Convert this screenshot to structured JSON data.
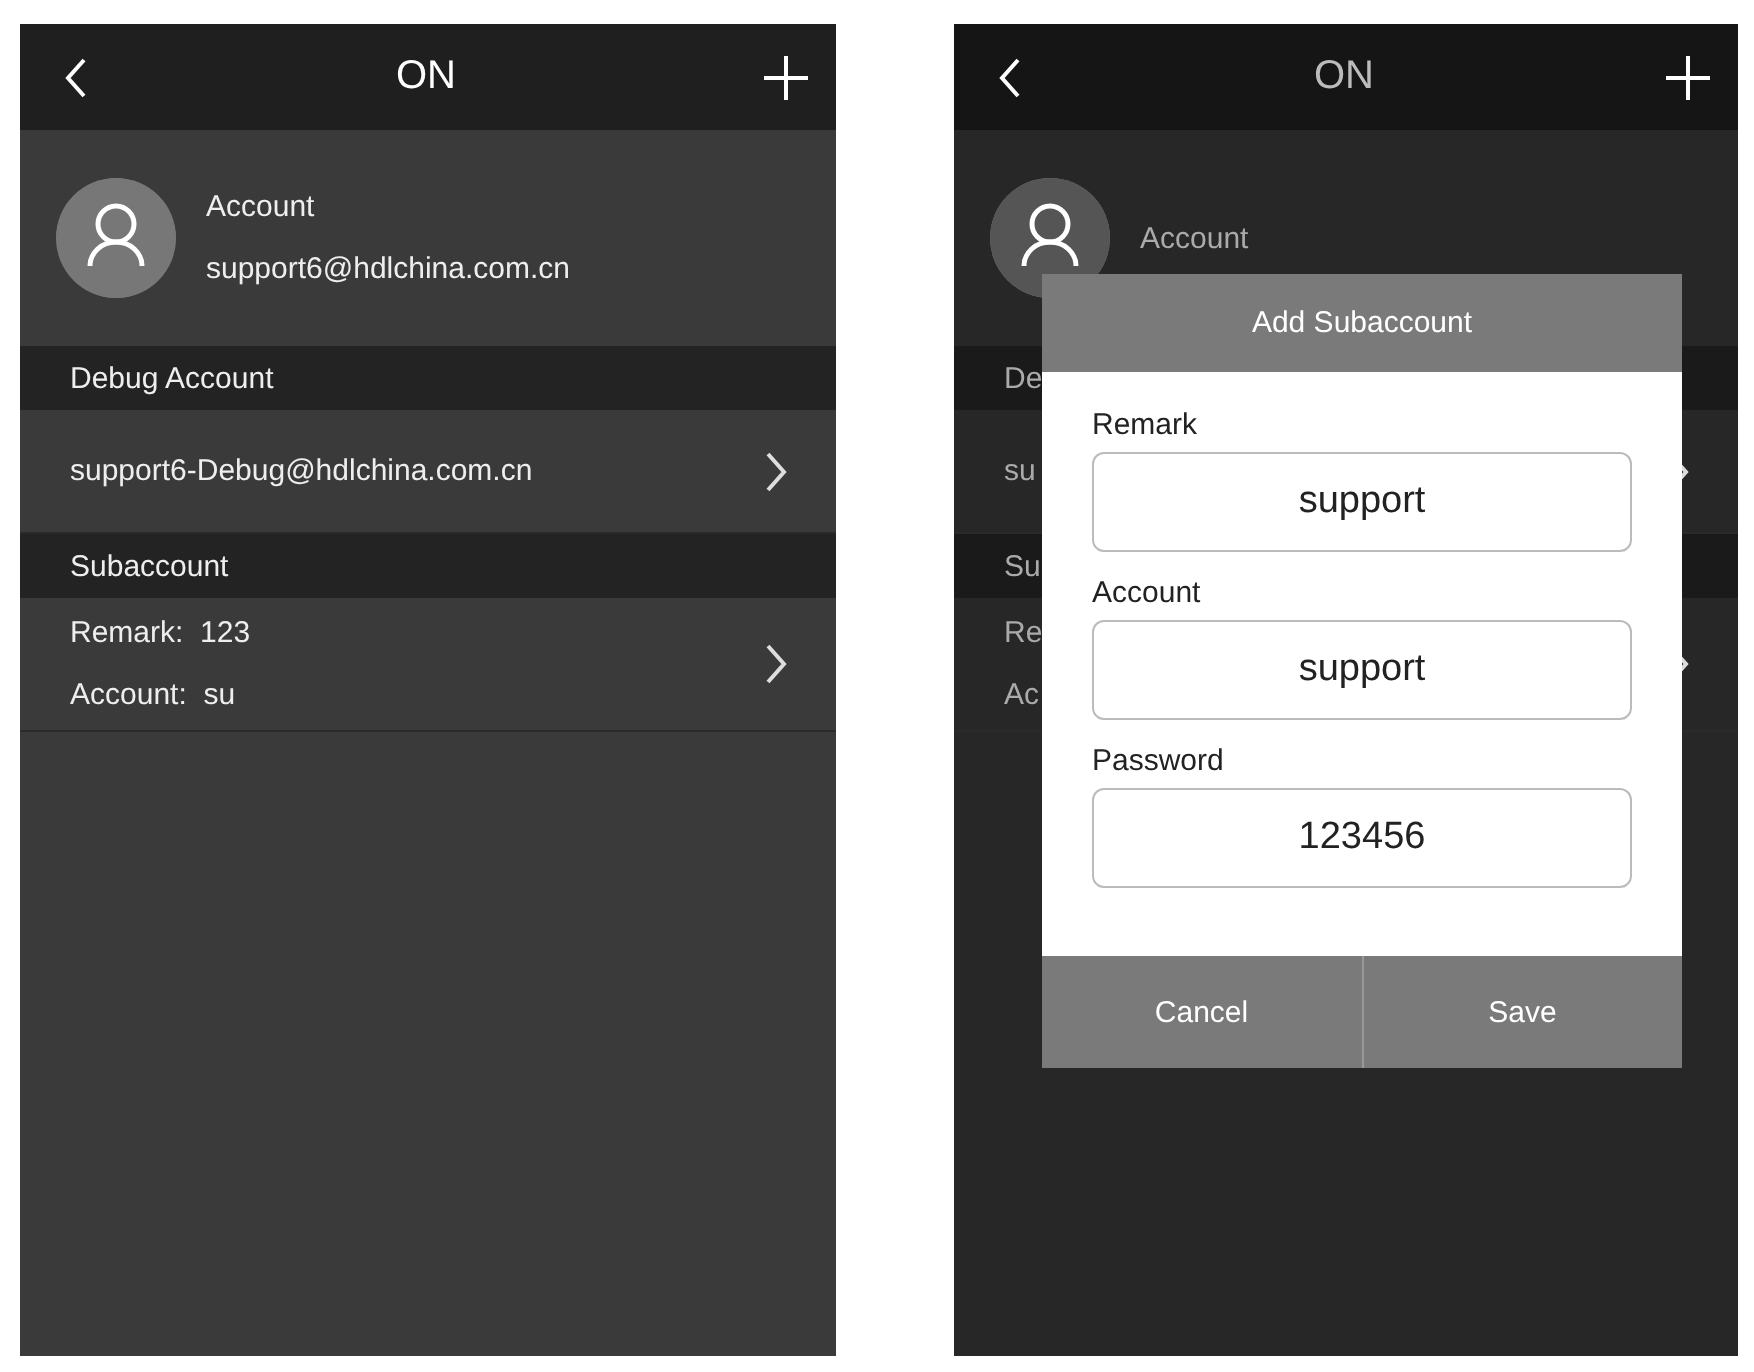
{
  "screens": [
    {
      "title": "ON",
      "dimmed": false,
      "account": {
        "label": "Account",
        "email": "support6@hdlchina.com.cn"
      },
      "sections": [
        {
          "heading": "Debug Account",
          "rows": [
            {
              "lines": [
                "support6-Debug@hdlchina.com.cn"
              ]
            }
          ]
        },
        {
          "heading": "Subaccount",
          "rows": [
            {
              "lines": [
                "Remark:  123",
                "Account:  su"
              ]
            }
          ]
        }
      ]
    },
    {
      "title": "ON",
      "dimmed": true,
      "account": {
        "label": "Account"
      },
      "sections": [
        {
          "heading": "De",
          "rows": [
            {
              "lines": [
                "su"
              ]
            }
          ]
        },
        {
          "heading": "Su",
          "rows": [
            {
              "lines": [
                "Re",
                "Ac"
              ]
            }
          ]
        }
      ],
      "dialog": {
        "title": "Add Subaccount",
        "fields": [
          {
            "label": "Remark",
            "value": "support"
          },
          {
            "label": "Account",
            "value": "support"
          },
          {
            "label": "Password",
            "value": "123456"
          }
        ],
        "buttons": [
          "Cancel",
          "Save"
        ]
      }
    }
  ]
}
